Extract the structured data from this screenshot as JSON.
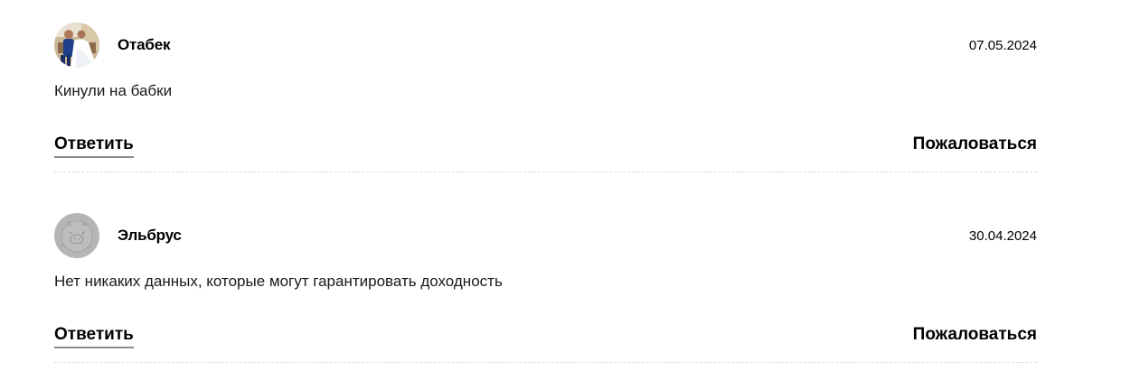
{
  "comments": [
    {
      "author": "Отабек",
      "date": "07.05.2024",
      "text": "Кинули на бабки",
      "avatar_icon": "wedding-photo-avatar",
      "reply_label": "Ответить",
      "report_label": "Пожаловаться"
    },
    {
      "author": "Эльбрус",
      "date": "30.04.2024",
      "text": "Нет никаких данных, которые могут гарантировать доходность",
      "avatar_icon": "piglet-placeholder-avatar",
      "reply_label": "Ответить",
      "report_label": "Пожаловаться"
    }
  ]
}
